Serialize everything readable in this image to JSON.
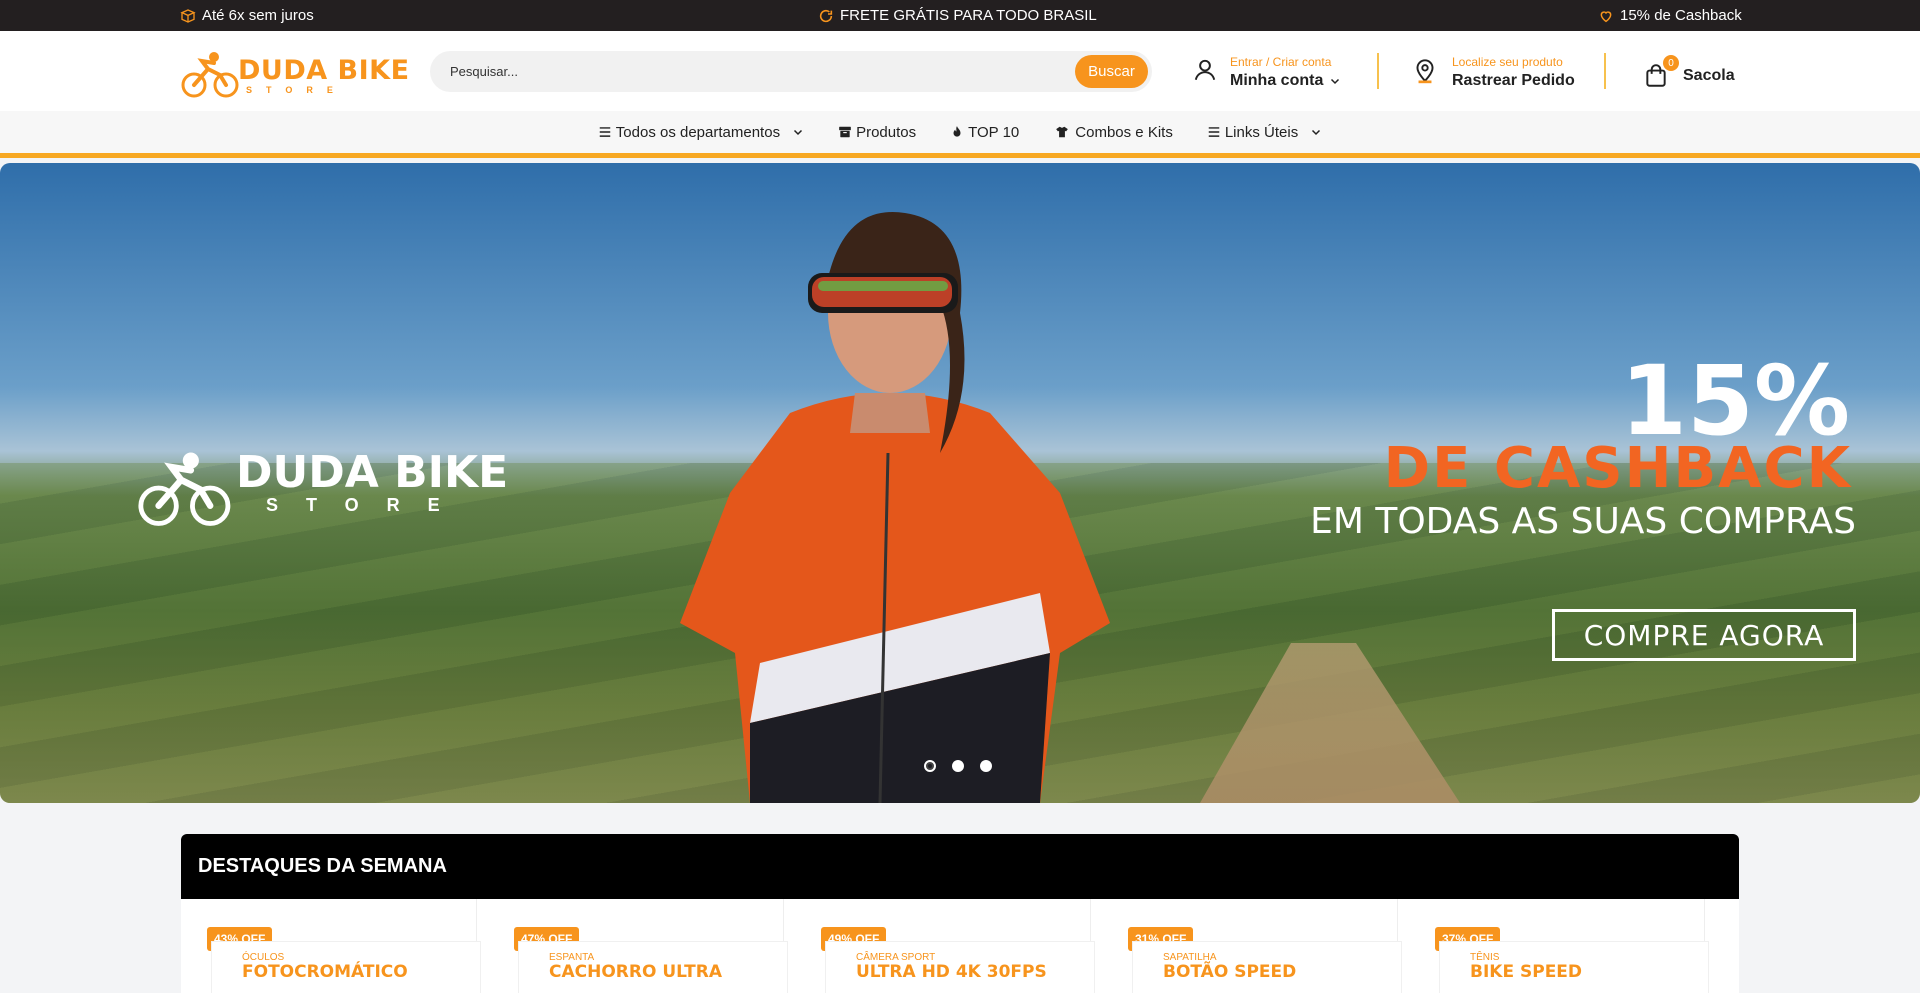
{
  "topbar": {
    "installments": "Até 6x sem juros",
    "shipping": "FRETE GRÁTIS PARA TODO BRASIL",
    "cashback": "15% de Cashback"
  },
  "header": {
    "logo_name": "DUDA BIKE",
    "logo_sub": "STORE",
    "search_placeholder": "Pesquisar...",
    "search_button": "Buscar",
    "account_small": "Entrar / Criar conta",
    "account_big": "Minha conta",
    "track_small": "Localize seu produto",
    "track_big": "Rastrear Pedido",
    "cart_count": "0",
    "cart_label": "Sacola"
  },
  "nav": {
    "items": [
      {
        "label": "Todos os departamentos",
        "icon": "menu-icon",
        "dropdown": true
      },
      {
        "label": "Produtos",
        "icon": "box-icon",
        "dropdown": false
      },
      {
        "label": "TOP 10",
        "icon": "fire-icon",
        "dropdown": false
      },
      {
        "label": "Combos e Kits",
        "icon": "shirt-icon",
        "dropdown": false
      },
      {
        "label": "Links Úteis",
        "icon": "menu-icon",
        "dropdown": true
      }
    ]
  },
  "hero": {
    "logo_name": "DUDA BIKE",
    "logo_sub": "STORE",
    "percent": "15%",
    "headline": "DE CASHBACK",
    "subline": "EM TODAS AS SUAS COMPRAS",
    "cta": "COMPRE AGORA",
    "slides": 3,
    "active_slide": 0
  },
  "highlights": {
    "title": "DESTAQUES DA SEMANA",
    "products": [
      {
        "discount": "43% OFF",
        "top": "ÓCULOS",
        "title": "FOTOCROMÁTICO"
      },
      {
        "discount": "47% OFF",
        "top": "ESPANTA",
        "title": "CACHORRO ULTRA"
      },
      {
        "discount": "49% OFF",
        "top": "CÂMERA SPORT",
        "title": "ULTRA HD 4K 30FPS"
      },
      {
        "discount": "31% OFF",
        "top": "SAPATILHA",
        "title": "BOTÃO SPEED"
      },
      {
        "discount": "37% OFF",
        "top": "TÊNIS",
        "title": "BIKE SPEED"
      }
    ]
  },
  "colors": {
    "accent": "#f7941d",
    "topbar_bg": "#231f20",
    "hero_orange": "#f26522"
  }
}
